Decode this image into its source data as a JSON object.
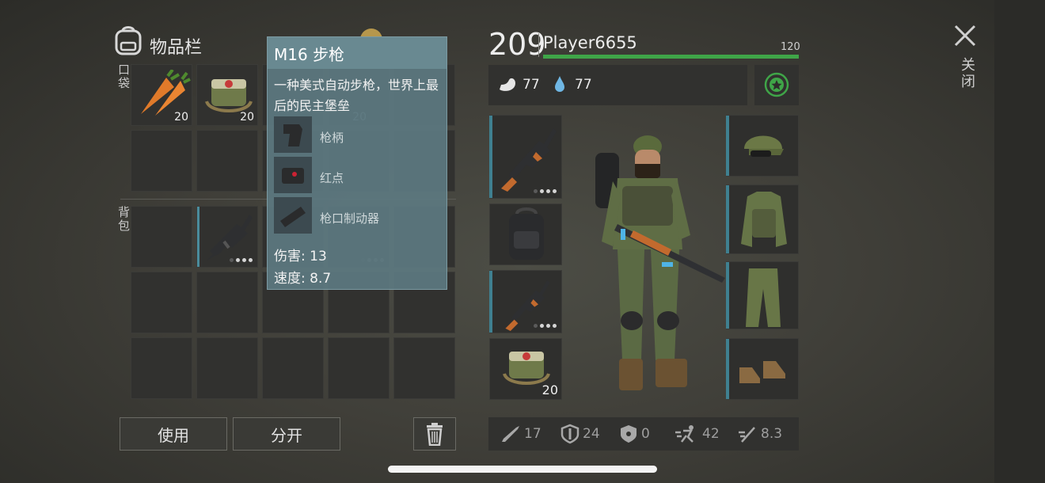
{
  "inventory": {
    "title": "物品栏",
    "pocket_label": "口袋",
    "backpack_label": "背包"
  },
  "pocket_slots": [
    {
      "icon": "carrot-icon",
      "count": "20"
    },
    {
      "icon": "medkit-bag-icon",
      "count": "20"
    },
    {
      "icon": "",
      "count": "20"
    }
  ],
  "backpack_slots": [
    {
      "icon": "m16-rifle-icon"
    }
  ],
  "tooltip": {
    "title": "M16 步枪",
    "description": "一种美式自动步枪，世界上最后的民主堡垒",
    "mods": [
      {
        "icon": "grip-icon",
        "label": "枪柄"
      },
      {
        "icon": "red-dot-sight-icon",
        "label": "红点"
      },
      {
        "icon": "muzzle-brake-icon",
        "label": "枪口制动器"
      }
    ],
    "damage": "伤害: 13",
    "speed": "速度: 8.7"
  },
  "actions": {
    "use": "使用",
    "split": "分开"
  },
  "player": {
    "level": "209",
    "name": "Player6655",
    "xp_value": "120",
    "food": "77",
    "water": "77",
    "xp_fraction": 1.0
  },
  "equipment": {
    "left": [
      {
        "icon": "ak47-rifle-icon"
      },
      {
        "icon": "backpack-icon"
      },
      {
        "icon": "ak47-rifle-icon"
      },
      {
        "icon": "medkit-bag-icon",
        "count": "20"
      }
    ],
    "right": [
      {
        "icon": "camo-cap-icon"
      },
      {
        "icon": "camo-vest-icon"
      },
      {
        "icon": "camo-pants-icon"
      },
      {
        "icon": "boots-icon"
      }
    ]
  },
  "stats": [
    {
      "icon": "melee-damage-icon",
      "value": "17"
    },
    {
      "icon": "armor-shield-icon",
      "value": "24"
    },
    {
      "icon": "radiation-shield-icon",
      "value": "0"
    },
    {
      "icon": "run-speed-icon",
      "value": "42"
    },
    {
      "icon": "attack-speed-icon",
      "value": "8.3"
    }
  ],
  "close_label": "关闭",
  "colors": {
    "xp_bar": "#3fa548",
    "accent": "#4a8c9c",
    "tooltip_bg": "#5d7880"
  }
}
